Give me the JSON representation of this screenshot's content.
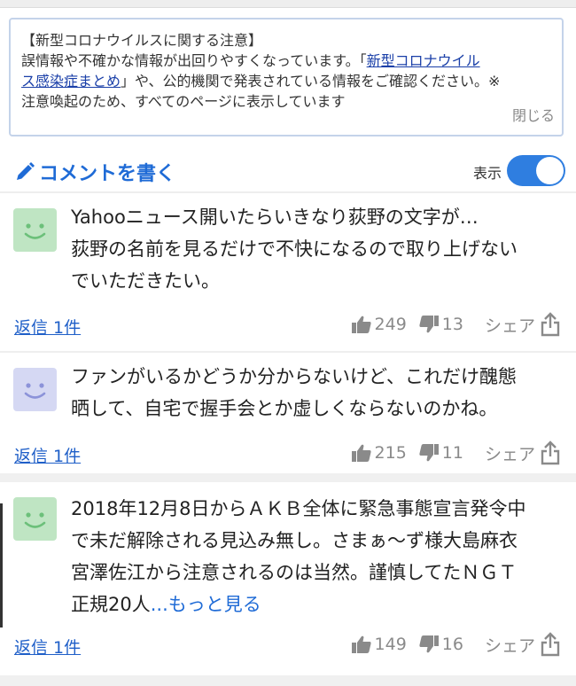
{
  "notice": {
    "title": "【新型コロナウイルスに関する注意】",
    "line1": "誤情報や不確かな情報が出回りやすくなっています。「",
    "link_part1": "新型コロナウイル",
    "link_part2": "ス感染症まとめ",
    "line2_rest": "」や、公的機関で発表されている情報をご確認ください。※",
    "line3": "注意喚起のため、すべてのページに表示しています",
    "close_label": "閉じる"
  },
  "comment_bar": {
    "write_label": "コメントを書く",
    "show_label": "表示",
    "toggle_on": true
  },
  "comments": [
    {
      "lines": [
        "Yahooニュース開いたらいきなり荻野の文字が…",
        "荻野の名前を見るだけで不快になるので取り上げない",
        "でいただきたい。"
      ],
      "reply": "返信 1件",
      "likes": "249",
      "dislikes": "13",
      "share": "シェア",
      "avatar_color": "#bfe5c3"
    },
    {
      "lines": [
        "ファンがいるかどうか分からないけど、これだけ醜態",
        "晒して、自宅で握手会とか虚しくならないのかね。"
      ],
      "reply": "返信 1件",
      "likes": "215",
      "dislikes": "11",
      "share": "シェア",
      "avatar_color": "#d5d8f3"
    },
    {
      "lines": [
        "2018年12月8日からＡＫＢ全体に緊急事態宣言発令中",
        "で未だ解除される見込み無し。さまぁ～ず様大島麻衣",
        "宮澤佐江から注意されるのは当然。謹慎してたＮＧＴ",
        "正規20人"
      ],
      "more": "...もっと見る",
      "reply": "返信 1件",
      "likes": "149",
      "dislikes": "16",
      "share": "シェア",
      "avatar_color": "#bfe5c3"
    }
  ]
}
